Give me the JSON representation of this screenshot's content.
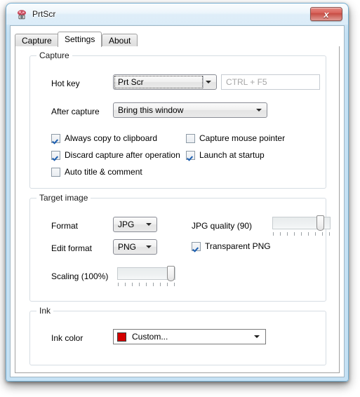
{
  "window": {
    "title": "PrtScr",
    "app_icon": "prtscr-app-icon",
    "close_label": "x",
    "close_icon": "close-icon"
  },
  "tabs": [
    {
      "label": "Capture",
      "active": false
    },
    {
      "label": "Settings",
      "active": true
    },
    {
      "label": "About",
      "active": false
    }
  ],
  "groups": {
    "capture": {
      "title": "Capture",
      "hotkey": {
        "label": "Hot key",
        "value": "Prt Scr",
        "focused": true,
        "preview_placeholder": "CTRL + F5"
      },
      "after_capture": {
        "label": "After capture",
        "value": "Bring this window"
      },
      "checkboxes": [
        {
          "label": "Always copy to clipboard",
          "checked": true
        },
        {
          "label": "Discard capture after operation",
          "checked": true
        },
        {
          "label": "Auto title & comment",
          "checked": false
        },
        {
          "label": "Capture mouse pointer",
          "checked": false
        },
        {
          "label": "Launch at startup",
          "checked": true
        }
      ]
    },
    "target_image": {
      "title": "Target image",
      "format": {
        "label": "Format",
        "value": "JPG"
      },
      "edit_format": {
        "label": "Edit format",
        "value": "PNG"
      },
      "jpg_quality": {
        "label": "JPG quality (90)",
        "value": 90,
        "min": 0,
        "max": 100,
        "ticks": 9
      },
      "transparent_png": {
        "label": "Transparent PNG",
        "checked": true
      },
      "scaling": {
        "label": "Scaling (100%)",
        "value": 100,
        "min": 0,
        "max": 100,
        "ticks": 9
      }
    },
    "ink": {
      "title": "Ink",
      "ink_color": {
        "label": "Ink color",
        "value": "Custom...",
        "swatch": "#d40000"
      }
    }
  },
  "colors": {
    "accent": "#d40000",
    "frame": "#c5e1f4",
    "close_button": "#c64b43",
    "check_mark": "#1d5fb0"
  }
}
